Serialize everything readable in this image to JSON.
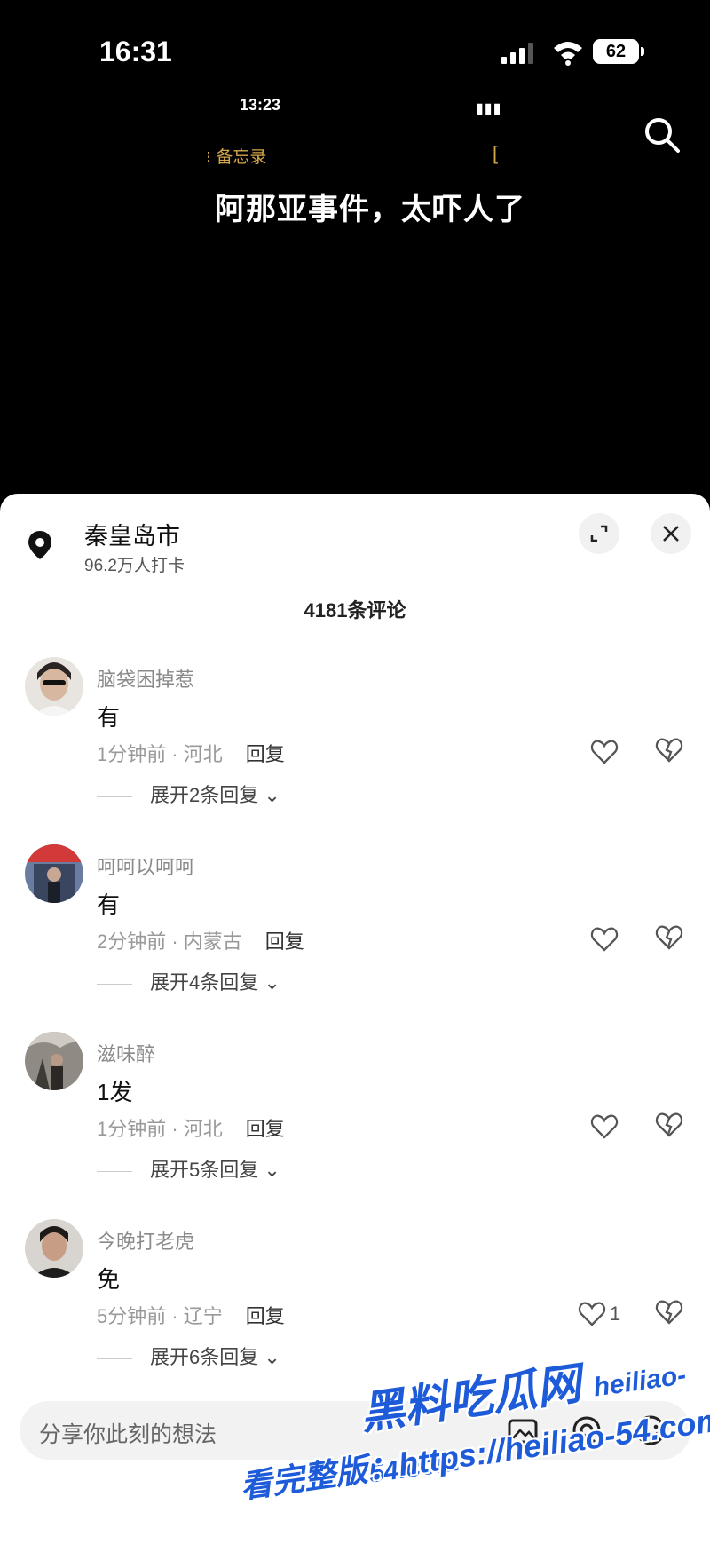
{
  "status_bar": {
    "time": "16:31",
    "battery": "62"
  },
  "video": {
    "inner_time": "13:23",
    "memo_label": "备忘录",
    "memo_bracket": "[",
    "headline": "阿那亚事件，太吓人了"
  },
  "location": {
    "name": "秦皇岛市",
    "checkins": "96.2万人打卡"
  },
  "comments_count": "4181条评论",
  "reply_label": "回复",
  "comments": [
    {
      "user": "脑袋困掉惹",
      "text": "有",
      "meta": "1分钟前 · 河北",
      "likes": "",
      "expand": "展开2条回复",
      "avatar_color": "#c9b8a8"
    },
    {
      "user": "呵呵以呵呵",
      "text": "有",
      "meta": "2分钟前 · 内蒙古",
      "likes": "",
      "expand": "展开4条回复",
      "avatar_color": "#4a5a78"
    },
    {
      "user": "滋味醉",
      "text": "1发",
      "meta": "1分钟前 · 河北",
      "likes": "",
      "expand": "展开5条回复",
      "avatar_color": "#7d7a74"
    },
    {
      "user": "今晚打老虎",
      "text": "免",
      "meta": "5分钟前 · 辽宁",
      "likes": "1",
      "expand": "展开6条回复",
      "avatar_color": "#3b3634"
    }
  ],
  "input": {
    "placeholder": "分享你此刻的想法"
  },
  "watermark": {
    "brand": "黑料吃瓜网",
    "site": "heiliao-54.com",
    "full": "看完整版：https://heiliao-54.com"
  }
}
